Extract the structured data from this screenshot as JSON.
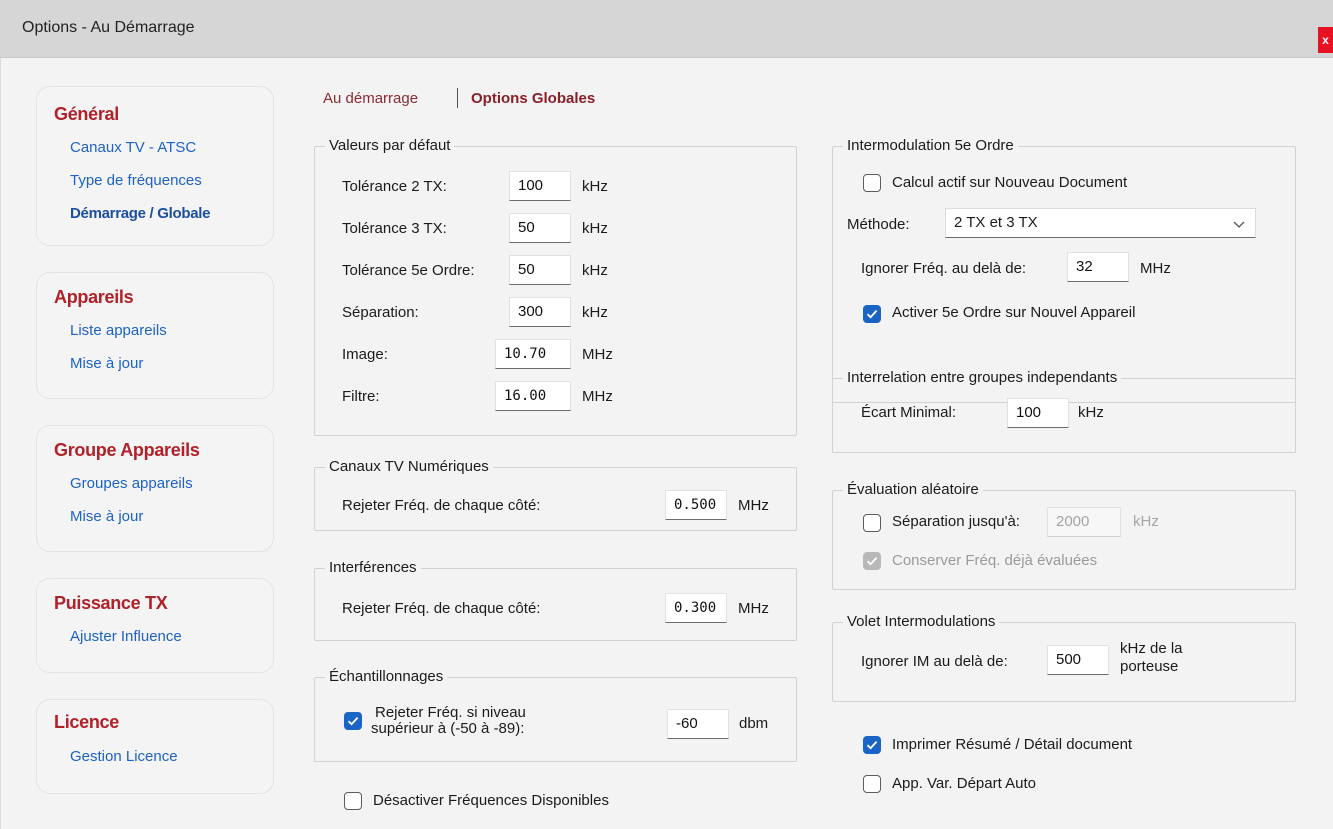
{
  "window": {
    "title": "Options - Au Démarrage",
    "close_label": "x"
  },
  "sidebar": [
    {
      "title": "Général",
      "links": [
        "Canaux TV - ATSC",
        "Type de fréquences",
        "Démarrage / Globale"
      ],
      "active": 2
    },
    {
      "title": "Appareils",
      "links": [
        "Liste appareils",
        "Mise à jour"
      ]
    },
    {
      "title": "Groupe Appareils",
      "links": [
        "Groupes appareils",
        "Mise à jour"
      ]
    },
    {
      "title": "Puissance TX",
      "links": [
        "Ajuster Influence"
      ]
    },
    {
      "title": "Licence",
      "links": [
        "Gestion Licence"
      ]
    }
  ],
  "tabs": {
    "tab1": "Au démarrage",
    "tab2": "Options Globales"
  },
  "defaults": {
    "title": "Valeurs par défaut",
    "rows": [
      {
        "label": "Tolérance 2 TX:",
        "value": "100",
        "unit": "kHz"
      },
      {
        "label": "Tolérance 3 TX:",
        "value": "50",
        "unit": "kHz"
      },
      {
        "label": "Tolérance 5e Ordre:",
        "value": "50",
        "unit": "kHz"
      },
      {
        "label": "Séparation:",
        "value": "300",
        "unit": "kHz"
      },
      {
        "label": "Image:",
        "value": "10.70",
        "unit": "MHz"
      },
      {
        "label": "Filtre:",
        "value": "16.00",
        "unit": "MHz"
      }
    ]
  },
  "tv_numeric": {
    "title": "Canaux TV Numériques",
    "label": "Rejeter Fréq. de chaque côté:",
    "value": "0.500",
    "unit": "MHz"
  },
  "interference": {
    "title": "Interférences",
    "label": "Rejeter Fréq. de chaque côté:",
    "value": "0.300",
    "unit": "MHz"
  },
  "sampling": {
    "title": "Échantillonnages",
    "label_line1": "Rejeter Fréq. si niveau",
    "label_line2": "supérieur à (-50 à -89):",
    "checked": true,
    "value": "-60",
    "unit": "dbm"
  },
  "disable_freq": {
    "label": "Désactiver Fréquences Disponibles",
    "checked": false
  },
  "im5": {
    "title": "Intermodulation 5e Ordre",
    "calc_label": "Calcul actif sur Nouveau Document",
    "calc_checked": false,
    "method_label": "Méthode:",
    "method_value": "2 TX et 3 TX",
    "ignore_label": "Ignorer Fréq. au delà de:",
    "ignore_value": "32",
    "ignore_unit": "MHz",
    "activate_label": "Activer 5e Ordre sur Nouvel Appareil",
    "activate_checked": true
  },
  "interrelation": {
    "title": "Interrelation entre groupes independants",
    "label": "Écart Minimal:",
    "value": "100",
    "unit": "kHz"
  },
  "random_eval": {
    "title": "Évaluation aléatoire",
    "sep_label": "Séparation jusqu'à:",
    "sep_checked": false,
    "sep_value": "2000",
    "sep_unit": "kHz",
    "keep_label": "Conserver Fréq. déjà évaluées",
    "keep_checked": true
  },
  "im_panel": {
    "title": "Volet Intermodulations",
    "label": "Ignorer IM au delà de:",
    "value": "500",
    "unit_line1": "kHz de la",
    "unit_line2": "porteuse"
  },
  "print_summary": {
    "label": "Imprimer Résumé / Détail document",
    "checked": true
  },
  "app_var": {
    "label": "App. Var. Départ Auto",
    "checked": false
  }
}
